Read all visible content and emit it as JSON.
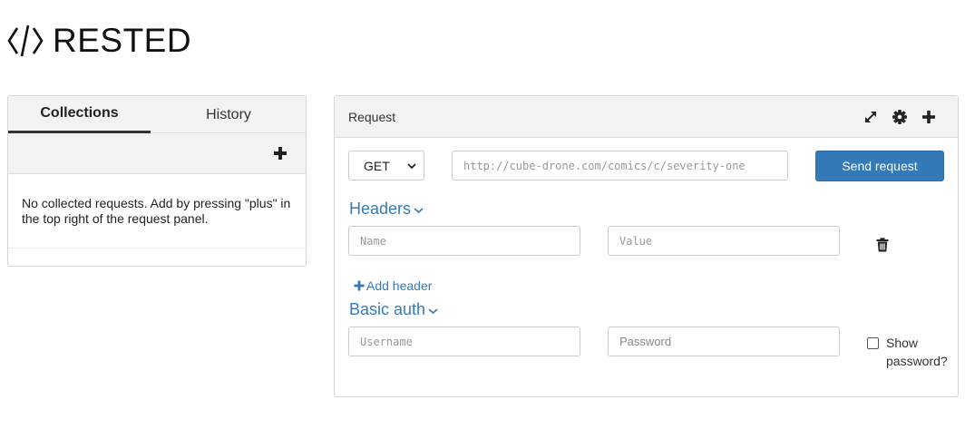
{
  "app": {
    "title": "RESTED",
    "logo_icon": "code-brackets-icon"
  },
  "collections": {
    "tabs": [
      {
        "label": "Collections",
        "active": true
      },
      {
        "label": "History",
        "active": false
      }
    ],
    "add_icon": "plus-icon",
    "empty_message": "No collected requests. Add by pressing \"plus\" in the top right of the request panel."
  },
  "request": {
    "title": "Request",
    "icons": [
      "expand-icon",
      "gear-icon",
      "plus-icon"
    ],
    "method": {
      "selected": "GET"
    },
    "url": {
      "placeholder": "http://cube-drone.com/comics/c/severity-one"
    },
    "send_label": "Send request",
    "headers": {
      "label": "Headers",
      "name_placeholder": "Name",
      "value_placeholder": "Value",
      "add_label": "Add header"
    },
    "basic_auth": {
      "label": "Basic auth",
      "username_placeholder": "Username",
      "password_placeholder": "Password",
      "show_password_label": "Show password?",
      "show_password_checked": false
    }
  },
  "colors": {
    "accent": "#337ab7",
    "panel_bg": "#f3f3f3",
    "border": "#d6d6d6"
  }
}
